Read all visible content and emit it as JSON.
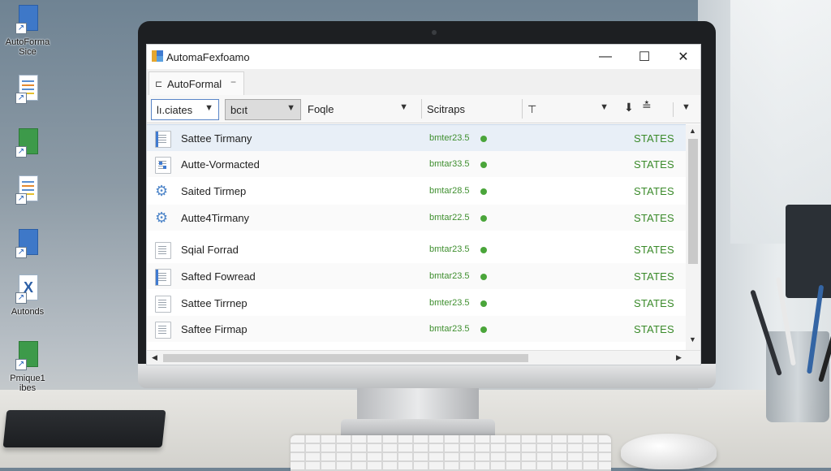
{
  "desktop": {
    "icons": [
      {
        "label": "AutoForma\nSice",
        "type": "blue-doc"
      },
      {
        "label": "",
        "type": "text-doc"
      },
      {
        "label": "",
        "type": "green-doc"
      },
      {
        "label": "",
        "type": "list-doc"
      },
      {
        "label": "",
        "type": "blue-doc"
      },
      {
        "label": "Autonds",
        "type": "x-doc"
      },
      {
        "label": "Pmique1\nibes",
        "type": "green-doc"
      }
    ]
  },
  "window": {
    "title": "AutomaFexfoamo",
    "minimize_glyph": "—",
    "maximize_glyph": "☐",
    "close_glyph": "✕"
  },
  "tab": {
    "icon": "⊏",
    "label": "AutoFormal",
    "close_glyph": "−"
  },
  "toolbar": {
    "filters": [
      {
        "label": "lı.ciates",
        "caret": "▼"
      },
      {
        "label": "bcıt",
        "caret": "▼"
      },
      {
        "label": "Foqle",
        "caret": "▼"
      },
      {
        "label": "Scitraps",
        "caret": ""
      },
      {
        "label": "⊤",
        "caret": "▼"
      }
    ],
    "pin_icon": "⬇",
    "sort_icon": "≛",
    "more_caret": "▼"
  },
  "columns": {
    "state_label": "STATES"
  },
  "rows": [
    {
      "name": "Sattee Tirmany",
      "size": "bmter23.5",
      "state": "STATES",
      "icon": "doc-blue",
      "selected": true
    },
    {
      "name": "Autte-Vormacted",
      "size": "bmtar33.5",
      "state": "STATES",
      "icon": "doc-grid"
    },
    {
      "name": "Saited Tirmep",
      "size": "bmtar28.5",
      "state": "STATES",
      "icon": "gear"
    },
    {
      "name": "Autte4Tirmany",
      "size": "bmtar22.5",
      "state": "STATES",
      "icon": "gear"
    },
    {
      "name": "Sqial Forrad",
      "size": "bmtar23.5",
      "state": "STATES",
      "icon": "doc"
    },
    {
      "name": "Safted Fowread",
      "size": "bmtar23.5",
      "state": "STATES",
      "icon": "doc-blue"
    },
    {
      "name": "Sattee Tirrnep",
      "size": "bmter23.5",
      "state": "STATES",
      "icon": "doc"
    },
    {
      "name": "Saftee Firmap",
      "size": "bmtar23.5",
      "state": "STATES",
      "icon": "doc"
    }
  ],
  "colors": {
    "accent_blue": "#3f7ad0",
    "state_green": "#3a8a2a",
    "dot_green": "#4aa53a"
  }
}
